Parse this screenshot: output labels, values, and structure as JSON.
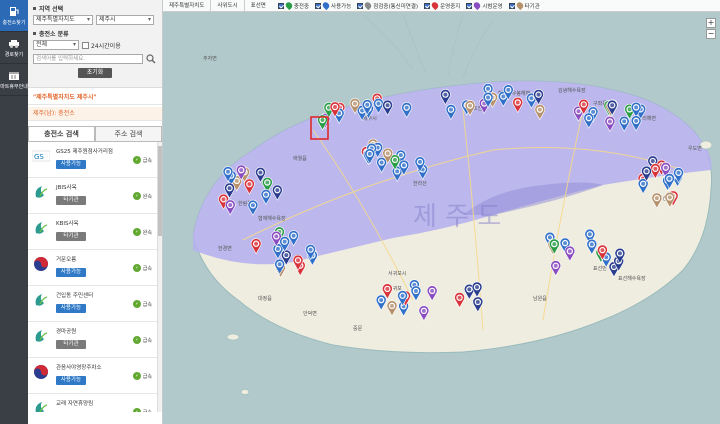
{
  "nav": {
    "items": [
      {
        "label": "충전소찾기",
        "icon": "charger-icon",
        "active": true
      },
      {
        "label": "경로찾기",
        "icon": "car-icon",
        "active": false
      },
      {
        "label": "마트휴무안내",
        "icon": "calendar-icon",
        "active": false
      }
    ]
  },
  "filter": {
    "region_label": "지역 선택",
    "province_value": "제주특별자치도",
    "city_value": "제주시",
    "type_label": "충전소 분류",
    "type_value": "전체",
    "open24_label": "24시간이용",
    "search_placeholder": "검색어를 입력하세요.",
    "reset_label": "초기화"
  },
  "region_title": "\"제주특별자치도 제주시\"",
  "section_head": "제주(남): 충전소",
  "tabs": [
    {
      "label": "충전소 검색",
      "active": true
    },
    {
      "label": "주소 검색",
      "active": false
    }
  ],
  "stations": [
    {
      "name": "GS25 제주원점사거리점",
      "status": "사용가능",
      "status_type": "available",
      "speed": "급속",
      "logo": "gs-logo-icon"
    },
    {
      "name": "JBIS사옥",
      "status": "타기관",
      "status_type": "other",
      "speed": "완속",
      "logo": "jeju-logo-icon"
    },
    {
      "name": "KBIS사옥",
      "status": "타기관",
      "status_type": "other",
      "speed": "완속",
      "logo": "jeju-logo-icon"
    },
    {
      "name": "거문오름",
      "status": "사용가능",
      "status_type": "available",
      "speed": "급속",
      "logo": "taegeuk-logo-icon"
    },
    {
      "name": "건입동 주민센터",
      "status": "사용가능",
      "status_type": "available",
      "speed": "급속",
      "logo": "jeju-logo-icon"
    },
    {
      "name": "경마공원",
      "status": "타기관",
      "status_type": "other",
      "speed": "급속",
      "logo": "jeju-logo-icon"
    },
    {
      "name": "관음사야영장주차소",
      "status": "사용가능",
      "status_type": "available",
      "speed": "급속",
      "logo": "taegeuk-logo-icon"
    },
    {
      "name": "교래 자연휴양림",
      "status": "사용가능",
      "status_type": "available",
      "speed": "급속",
      "logo": "jeju-logo-icon"
    }
  ],
  "legend": {
    "zoom_in_label": "제주특별자치도",
    "mode_label": "사위도시",
    "marker_label": "표선면",
    "items": [
      {
        "label": "충전중",
        "color": "#2a9d47"
      },
      {
        "label": "사용가능",
        "color": "#3170c9"
      },
      {
        "label": "점검중(통신미연결)",
        "color": "#8a8a8a"
      },
      {
        "label": "운영중지",
        "color": "#d9333a"
      },
      {
        "label": "시범운영",
        "color": "#8a4dc1"
      },
      {
        "label": "타기관",
        "color": "#b7916b"
      }
    ]
  },
  "map": {
    "island_label": "제 주 도",
    "labels": [
      "한림읍",
      "애월읍",
      "제주시",
      "조천읍",
      "구좌읍",
      "한경면",
      "대정읍",
      "안덕면",
      "서귀포시",
      "남원읍",
      "표선면",
      "성산읍",
      "한라산",
      "서귀포",
      "중문",
      "표선해수욕장",
      "함덕서우봉해변",
      "김녕해수욕장",
      "월정리해변",
      "협재해수욕장",
      "추자면",
      "우도면"
    ]
  }
}
